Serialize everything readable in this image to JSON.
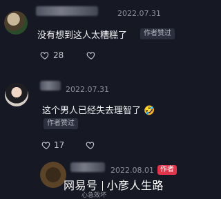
{
  "comments": [
    {
      "date": "2022.07.31",
      "text": "没有想到这人太糟糕了",
      "badge": "作者赞过",
      "likes": "28"
    },
    {
      "date": "2022.07.31",
      "text": "这个男人已经失去理智了 🤣",
      "badge": "作者赞过",
      "likes": "17"
    },
    {
      "date": "2022.08.01",
      "author_tag": "作者",
      "snippet": "心急效坏"
    }
  ],
  "watermark": {
    "left": "网易号",
    "right": "小彦人生路"
  },
  "colors": {
    "background": "#161824",
    "author_tag": "#e0354a",
    "badge_bg": "#2c2f3d"
  }
}
